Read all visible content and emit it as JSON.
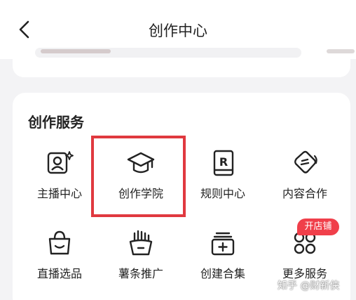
{
  "header": {
    "title": "创作中心"
  },
  "services": {
    "title": "创作服务",
    "items": [
      {
        "label": "主播中心",
        "icon": "anchor-center-icon"
      },
      {
        "label": "创作学院",
        "icon": "graduation-cap-icon"
      },
      {
        "label": "规则中心",
        "icon": "rulebook-icon"
      },
      {
        "label": "内容合作",
        "icon": "content-cooperation-icon"
      },
      {
        "label": "直播选品",
        "icon": "shopping-bag-icon"
      },
      {
        "label": "薯条推广",
        "icon": "fries-icon"
      },
      {
        "label": "创建合集",
        "icon": "add-collection-icon"
      },
      {
        "label": "更多服务",
        "icon": "more-services-icon"
      }
    ],
    "badge": "开店铺"
  },
  "watermark": "知乎 @财新侠",
  "colors": {
    "highlight": "#e0393f",
    "badge": "#f03f4a",
    "icon": "#222222"
  }
}
